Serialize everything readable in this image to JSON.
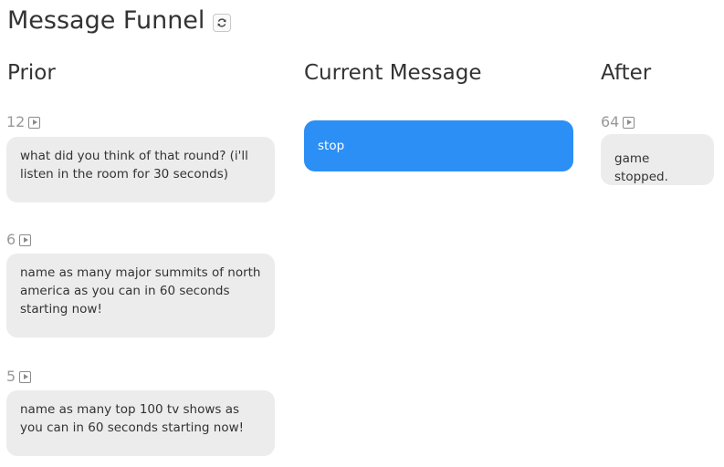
{
  "page_title": "Message Funnel",
  "columns": {
    "prior": "Prior",
    "current": "Current Message",
    "after": "After"
  },
  "prior_messages": [
    {
      "count": "12",
      "text": "what did you think of that round? (i'll listen in the room for 30 seconds)"
    },
    {
      "count": "6",
      "text": "name as many major summits of north america as you can in 60 seconds starting now!"
    },
    {
      "count": "5",
      "text": "name as many top 100 tv shows as you can in 60 seconds starting now!"
    }
  ],
  "current_message": {
    "text": "stop"
  },
  "after_messages": [
    {
      "count": "64",
      "text": "game stopped."
    }
  ],
  "colors": {
    "current_bubble": "#2b8ff5",
    "bubble": "#ececec"
  },
  "icons": {
    "refresh": "refresh-icon",
    "play": "play-icon"
  }
}
